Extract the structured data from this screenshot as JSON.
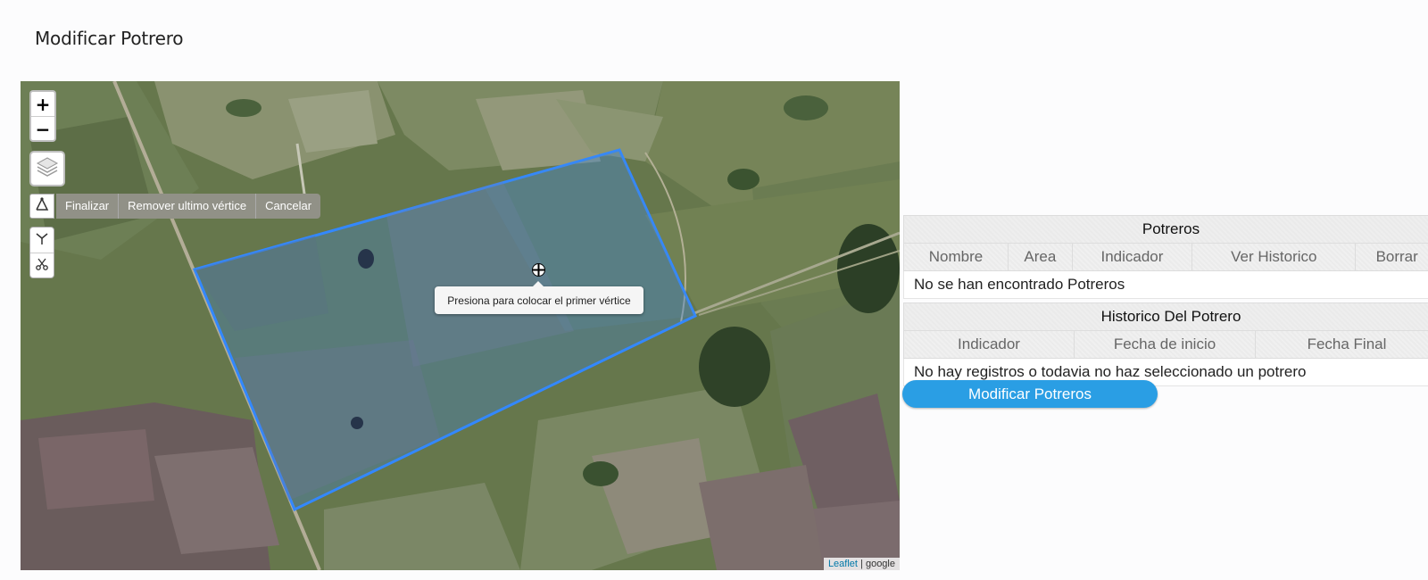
{
  "page": {
    "title": "Modificar Potrero"
  },
  "map": {
    "zoom_in": "+",
    "zoom_out": "−",
    "draw_actions": {
      "finish": "Finalizar",
      "remove_last": "Remover ultimo vértice",
      "cancel": "Cancelar"
    },
    "tooltip": "Presiona para colocar el primer vértice",
    "attribution": {
      "link": "Leaflet",
      "separator": " | ",
      "provider": "google"
    },
    "icons": [
      "layers-icon",
      "draw-polygon-icon",
      "edit-icon",
      "cut-icon",
      "crosshair-icon"
    ],
    "polygon_color": "#3388ff"
  },
  "potreros_table": {
    "title": "Potreros",
    "columns": [
      "Nombre",
      "Area",
      "Indicador",
      "Ver Historico",
      "Borrar"
    ],
    "empty_message": "No se han encontrado Potreros"
  },
  "historico_table": {
    "title": "Historico Del Potrero",
    "columns": [
      "Indicador",
      "Fecha de inicio",
      "Fecha Final"
    ],
    "empty_message": "No hay registros o todavia no haz seleccionado un potrero"
  },
  "modify_button": {
    "label": "Modificar Potreros",
    "color": "#2a9ee4"
  }
}
